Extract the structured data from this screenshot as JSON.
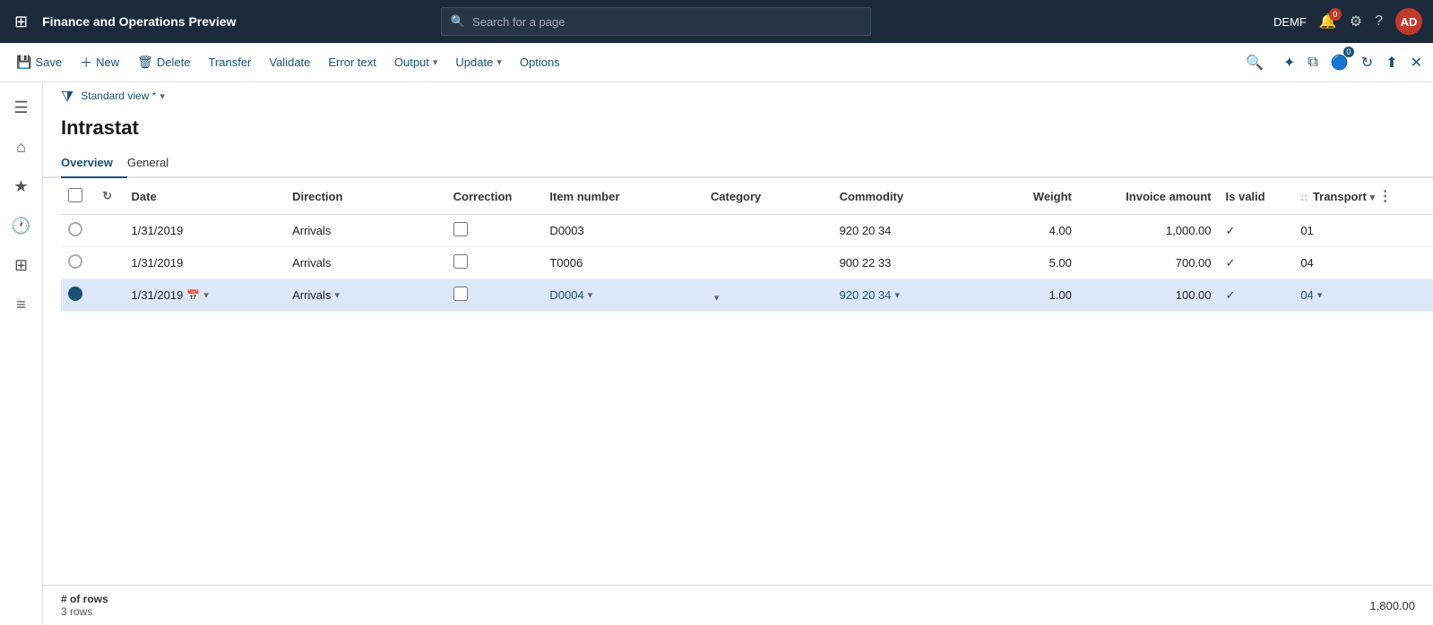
{
  "app": {
    "title": "Finance and Operations Preview",
    "env": "DEMF"
  },
  "topnav": {
    "grid_icon": "⊞",
    "search_placeholder": "Search for a page",
    "username": "DEMF",
    "notification_icon": "🔔",
    "settings_icon": "⚙",
    "help_icon": "?",
    "avatar_initials": "AD",
    "notification_count": "0"
  },
  "toolbar": {
    "save_label": "Save",
    "new_label": "New",
    "delete_label": "Delete",
    "transfer_label": "Transfer",
    "validate_label": "Validate",
    "error_text_label": "Error text",
    "output_label": "Output",
    "update_label": "Update",
    "options_label": "Options"
  },
  "sidebar": {
    "icons": [
      "hamburger",
      "home",
      "star",
      "clock",
      "calendar",
      "list"
    ]
  },
  "page": {
    "view_label": "Standard view *",
    "title": "Intrastat",
    "tabs": [
      {
        "label": "Overview",
        "active": true
      },
      {
        "label": "General",
        "active": false
      }
    ]
  },
  "table": {
    "headers": [
      {
        "label": "",
        "key": "select_all",
        "type": "checkbox"
      },
      {
        "label": "",
        "key": "refresh",
        "type": "refresh"
      },
      {
        "label": "Date",
        "key": "date"
      },
      {
        "label": "",
        "key": "date_icon",
        "type": "icon"
      },
      {
        "label": "Direction",
        "key": "direction"
      },
      {
        "label": "Correction",
        "key": "correction"
      },
      {
        "label": "Item number",
        "key": "item_number"
      },
      {
        "label": "Category",
        "key": "category"
      },
      {
        "label": "Commodity",
        "key": "commodity"
      },
      {
        "label": "Weight",
        "key": "weight",
        "align": "right"
      },
      {
        "label": "Invoice amount",
        "key": "invoice_amount",
        "align": "right"
      },
      {
        "label": "Is valid",
        "key": "is_valid"
      },
      {
        "label": "Transport",
        "key": "transport"
      }
    ],
    "rows": [
      {
        "selected": false,
        "date": "1/31/2019",
        "direction": "Arrivals",
        "correction": false,
        "item_number": "D0003",
        "item_link": false,
        "category": "",
        "commodity": "920 20 34",
        "weight": "4.00",
        "invoice_amount": "1,000.00",
        "is_valid": true,
        "transport": "01"
      },
      {
        "selected": false,
        "date": "1/31/2019",
        "direction": "Arrivals",
        "correction": false,
        "item_number": "T0006",
        "item_link": false,
        "category": "",
        "commodity": "900 22 33",
        "weight": "5.00",
        "invoice_amount": "700.00",
        "is_valid": true,
        "transport": "04"
      },
      {
        "selected": true,
        "date": "1/31/2019",
        "direction": "Arrivals",
        "correction": false,
        "item_number": "D0004",
        "item_link": true,
        "category": "",
        "commodity": "920 20 34",
        "weight": "1.00",
        "invoice_amount": "100.00",
        "is_valid": true,
        "transport": "04",
        "editing": true
      }
    ]
  },
  "footer": {
    "rows_label": "# of rows",
    "rows_count_label": "3 rows",
    "total_label": "1,800.00"
  }
}
